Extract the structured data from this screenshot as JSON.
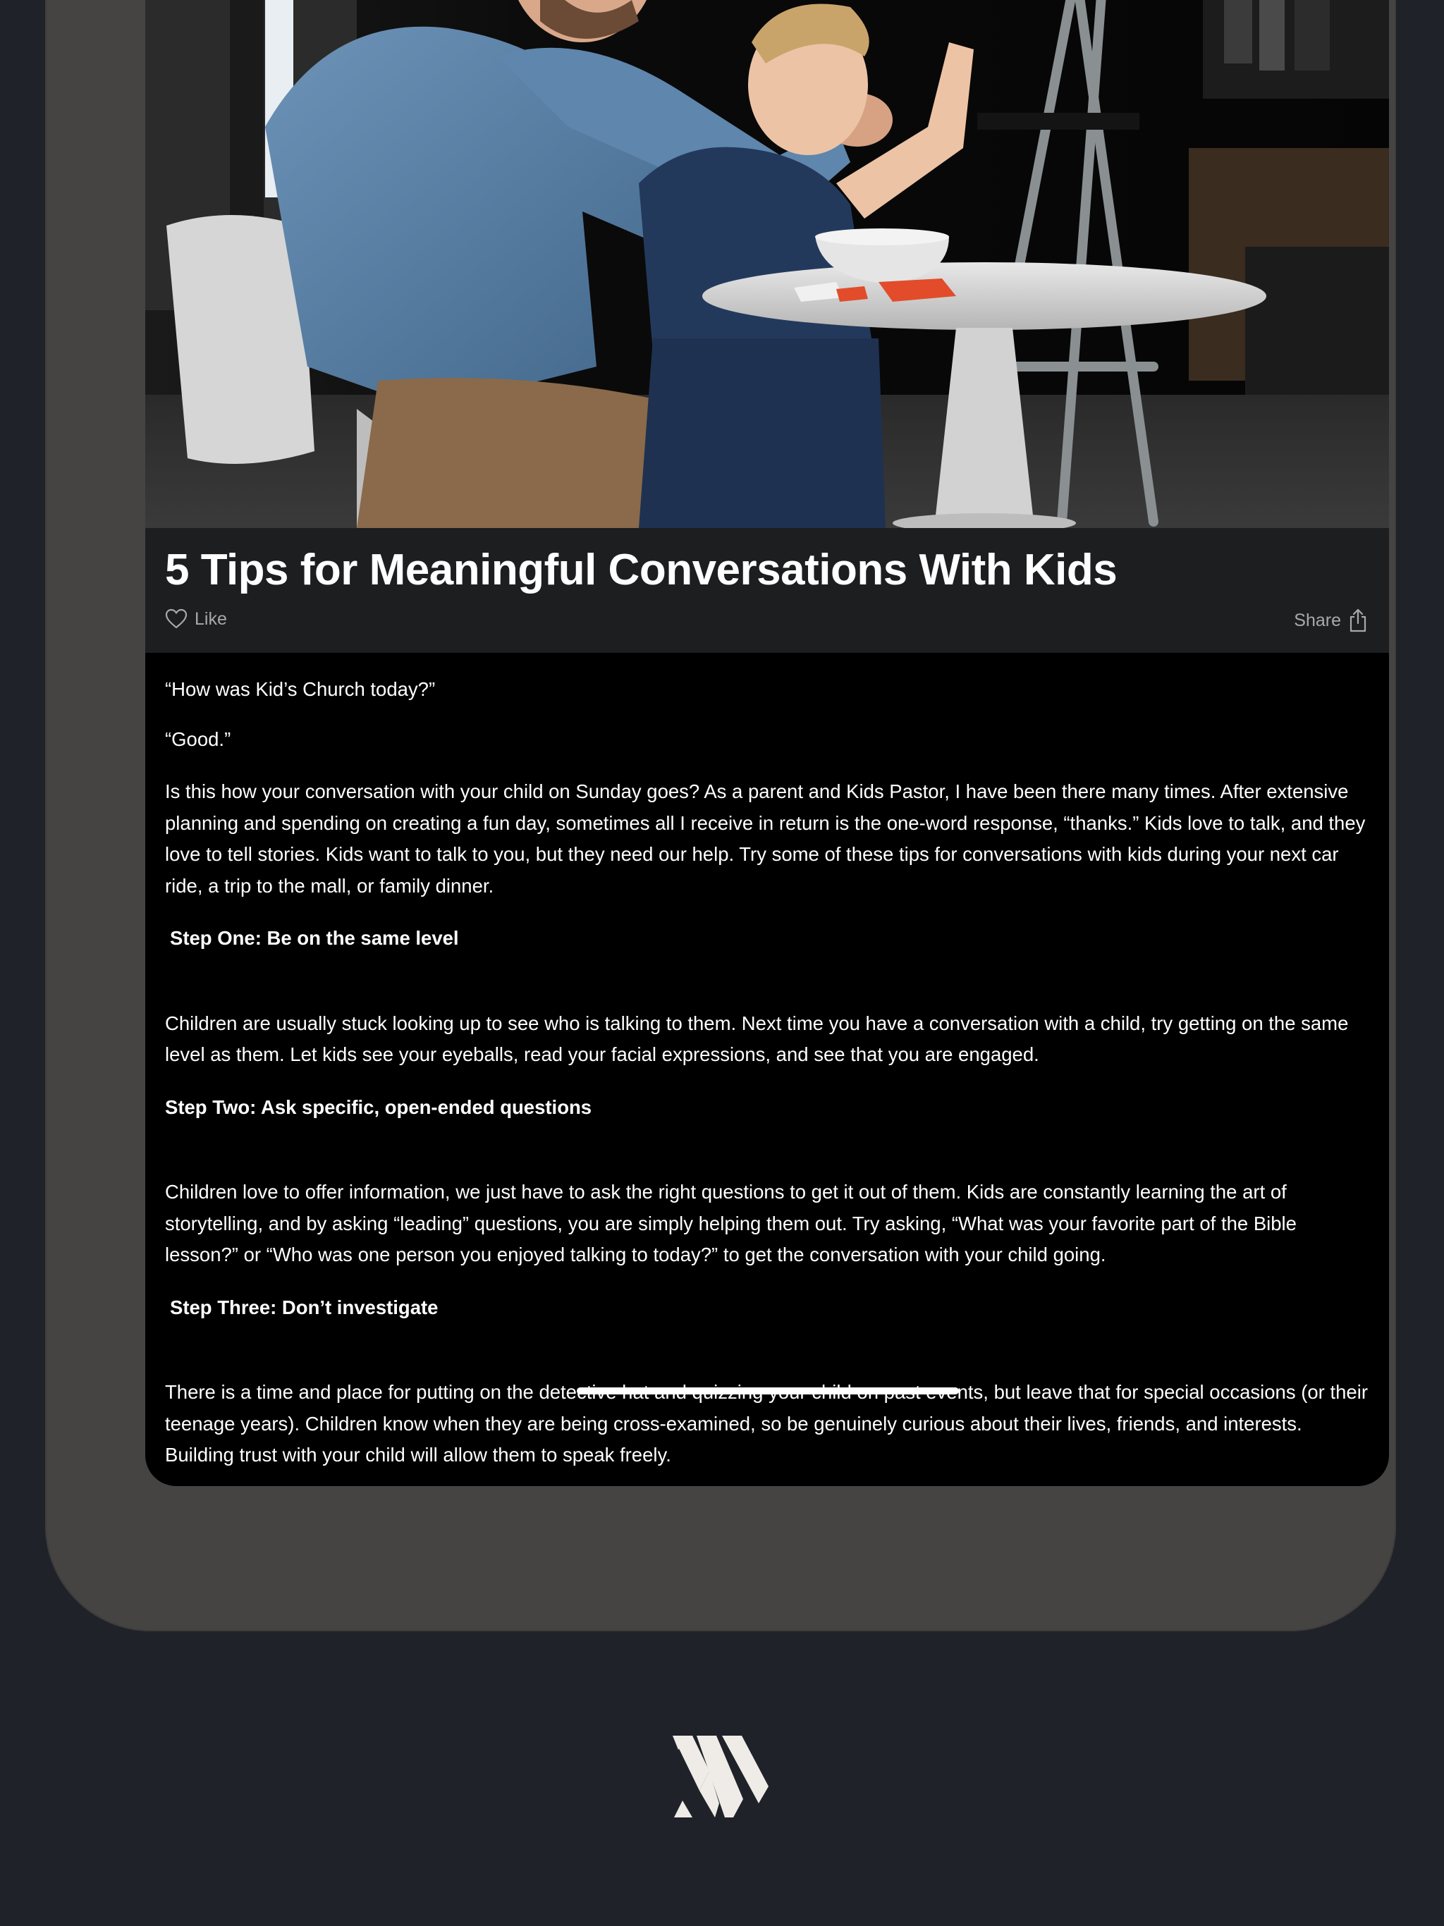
{
  "article": {
    "title": "5 Tips for Meaningful Conversations With Kids",
    "like_label": "Like",
    "share_label": "Share",
    "quote_question": "“How was Kid’s Church today?”",
    "quote_answer": "“Good.”",
    "intro": "Is this how your conversation with your child on Sunday goes? As a parent and Kids Pastor, I have been there many times. After extensive planning and spending on creating a fun day, sometimes all I receive in return is the one-word response, “thanks.” Kids love to talk, and they love to tell stories. Kids want to talk to you, but they need our help. Try some of these tips for conversations with kids during your next car ride, a trip to the mall, or family dinner.",
    "steps": [
      {
        "heading": "Step One: Be on the same level",
        "body": "Children are usually stuck looking up to see who is talking to them. Next time you have a conversation with a child, try getting on the same level as them. Let kids see your eyeballs, read your facial expressions, and see that you are engaged."
      },
      {
        "heading": "Step Two: Ask specific, open-ended questions",
        "body": "Children love to offer information, we just have to ask the right questions to get it out of them. Kids are constantly learning the art of storytelling, and by asking “leading” questions, you are simply helping them out. Try asking, “What was your favorite part of the Bible lesson?” or “Who was one person you enjoyed talking to today?” to get the conversation with your child going."
      },
      {
        "heading": "Step Three: Don’t investigate",
        "body": "There is a time and place for putting on the detective hat and quizzing your child on past events, but leave that for special occasions (or their teenage years). Children know when they are being cross-examined, so be genuinely curious about their lives, friends, and interests. Building trust with your child will allow them to speak freely."
      }
    ]
  },
  "icons": {
    "like": "heart-icon",
    "share": "share-icon",
    "brand": "brand-logo"
  },
  "colors": {
    "page_background": "#1f2229",
    "device_frame": "#454443",
    "title_bar": "#1d1e1f",
    "text": "#ffffff",
    "muted_text": "#a9a9a9"
  }
}
